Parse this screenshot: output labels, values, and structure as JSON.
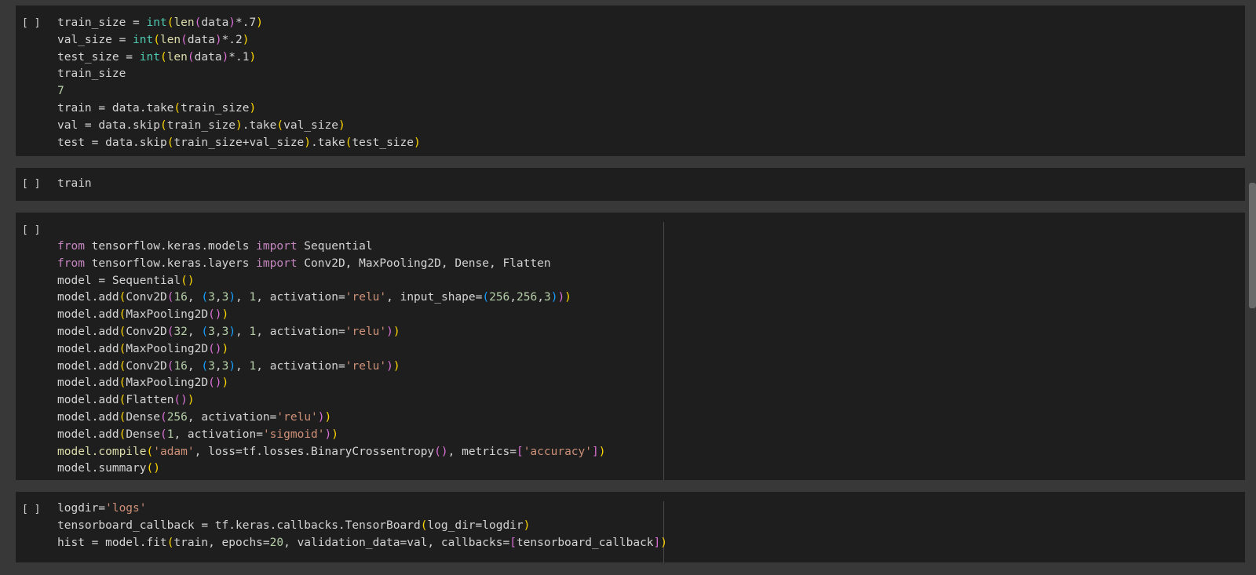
{
  "notebook": {
    "cells": [
      {
        "run_label": "[ ]",
        "lines": [
          [
            [
              "train_size = ",
              "plain"
            ],
            [
              "int",
              "builtin"
            ],
            [
              "(",
              "paren1"
            ],
            [
              "len",
              "func"
            ],
            [
              "(",
              "paren2"
            ],
            [
              "data",
              "plain"
            ],
            [
              ")",
              "paren2"
            ],
            [
              "*.7",
              "plain"
            ],
            [
              ")",
              "paren1"
            ]
          ],
          [
            [
              "val_size = ",
              "plain"
            ],
            [
              "int",
              "builtin"
            ],
            [
              "(",
              "paren1"
            ],
            [
              "len",
              "func"
            ],
            [
              "(",
              "paren2"
            ],
            [
              "data",
              "plain"
            ],
            [
              ")",
              "paren2"
            ],
            [
              "*.2",
              "plain"
            ],
            [
              ")",
              "paren1"
            ]
          ],
          [
            [
              "test_size = ",
              "plain"
            ],
            [
              "int",
              "builtin"
            ],
            [
              "(",
              "paren1"
            ],
            [
              "len",
              "func"
            ],
            [
              "(",
              "paren2"
            ],
            [
              "data",
              "plain"
            ],
            [
              ")",
              "paren2"
            ],
            [
              "*.1",
              "plain"
            ],
            [
              ")",
              "paren1"
            ]
          ],
          [
            [
              "train_size",
              "plain"
            ]
          ],
          [
            [
              "7",
              "number"
            ]
          ],
          [
            [
              "train = data.take",
              "plain"
            ],
            [
              "(",
              "paren1"
            ],
            [
              "train_size",
              "plain"
            ],
            [
              ")",
              "paren1"
            ]
          ],
          [
            [
              "val = data.skip",
              "plain"
            ],
            [
              "(",
              "paren1"
            ],
            [
              "train_size",
              "plain"
            ],
            [
              ")",
              "paren1"
            ],
            [
              ".take",
              "plain"
            ],
            [
              "(",
              "paren1"
            ],
            [
              "val_size",
              "plain"
            ],
            [
              ")",
              "paren1"
            ]
          ],
          [
            [
              "test = data.skip",
              "plain"
            ],
            [
              "(",
              "paren1"
            ],
            [
              "train_size+val_size",
              "plain"
            ],
            [
              ")",
              "paren1"
            ],
            [
              ".take",
              "plain"
            ],
            [
              "(",
              "paren1"
            ],
            [
              "test_size",
              "plain"
            ],
            [
              ")",
              "paren1"
            ]
          ]
        ]
      },
      {
        "run_label": "[ ]",
        "lines": [
          [
            [
              "train",
              "plain"
            ]
          ]
        ]
      },
      {
        "run_label": "[ ]",
        "lines": [
          [
            [
              "from",
              "keyword"
            ],
            [
              " tensorflow.keras.models ",
              "plain"
            ],
            [
              "import",
              "keyword"
            ],
            [
              " Sequential",
              "plain"
            ]
          ],
          [
            [
              "from",
              "keyword"
            ],
            [
              " tensorflow.keras.layers ",
              "plain"
            ],
            [
              "import",
              "keyword"
            ],
            [
              " Conv2D, MaxPooling2D, Dense, Flatten",
              "plain"
            ]
          ],
          [
            [
              "model = Sequential",
              "plain"
            ],
            [
              "()",
              "paren1"
            ]
          ],
          [
            [
              "model.add",
              "plain"
            ],
            [
              "(",
              "paren1"
            ],
            [
              "Conv2D",
              "plain"
            ],
            [
              "(",
              "paren2"
            ],
            [
              "16",
              "number"
            ],
            [
              ", ",
              "plain"
            ],
            [
              "(",
              "paren3"
            ],
            [
              "3",
              "number"
            ],
            [
              ",",
              "plain"
            ],
            [
              "3",
              "number"
            ],
            [
              ")",
              "paren3"
            ],
            [
              ", ",
              "plain"
            ],
            [
              "1",
              "number"
            ],
            [
              ", activation=",
              "plain"
            ],
            [
              "'relu'",
              "string"
            ],
            [
              ", input_shape=",
              "plain"
            ],
            [
              "(",
              "paren3"
            ],
            [
              "256",
              "number"
            ],
            [
              ",",
              "plain"
            ],
            [
              "256",
              "number"
            ],
            [
              ",",
              "plain"
            ],
            [
              "3",
              "number"
            ],
            [
              ")",
              "paren3"
            ],
            [
              ")",
              "paren2"
            ],
            [
              ")",
              "paren1"
            ]
          ],
          [
            [
              "model.add",
              "plain"
            ],
            [
              "(",
              "paren1"
            ],
            [
              "MaxPooling2D",
              "plain"
            ],
            [
              "()",
              "paren2"
            ],
            [
              ")",
              "paren1"
            ]
          ],
          [
            [
              "model.add",
              "plain"
            ],
            [
              "(",
              "paren1"
            ],
            [
              "Conv2D",
              "plain"
            ],
            [
              "(",
              "paren2"
            ],
            [
              "32",
              "number"
            ],
            [
              ", ",
              "plain"
            ],
            [
              "(",
              "paren3"
            ],
            [
              "3",
              "number"
            ],
            [
              ",",
              "plain"
            ],
            [
              "3",
              "number"
            ],
            [
              ")",
              "paren3"
            ],
            [
              ", ",
              "plain"
            ],
            [
              "1",
              "number"
            ],
            [
              ", activation=",
              "plain"
            ],
            [
              "'relu'",
              "string"
            ],
            [
              ")",
              "paren2"
            ],
            [
              ")",
              "paren1"
            ]
          ],
          [
            [
              "model.add",
              "plain"
            ],
            [
              "(",
              "paren1"
            ],
            [
              "MaxPooling2D",
              "plain"
            ],
            [
              "()",
              "paren2"
            ],
            [
              ")",
              "paren1"
            ]
          ],
          [
            [
              "model.add",
              "plain"
            ],
            [
              "(",
              "paren1"
            ],
            [
              "Conv2D",
              "plain"
            ],
            [
              "(",
              "paren2"
            ],
            [
              "16",
              "number"
            ],
            [
              ", ",
              "plain"
            ],
            [
              "(",
              "paren3"
            ],
            [
              "3",
              "number"
            ],
            [
              ",",
              "plain"
            ],
            [
              "3",
              "number"
            ],
            [
              ")",
              "paren3"
            ],
            [
              ", ",
              "plain"
            ],
            [
              "1",
              "number"
            ],
            [
              ", activation=",
              "plain"
            ],
            [
              "'relu'",
              "string"
            ],
            [
              ")",
              "paren2"
            ],
            [
              ")",
              "paren1"
            ]
          ],
          [
            [
              "model.add",
              "plain"
            ],
            [
              "(",
              "paren1"
            ],
            [
              "MaxPooling2D",
              "plain"
            ],
            [
              "()",
              "paren2"
            ],
            [
              ")",
              "paren1"
            ]
          ],
          [
            [
              "model.add",
              "plain"
            ],
            [
              "(",
              "paren1"
            ],
            [
              "Flatten",
              "plain"
            ],
            [
              "()",
              "paren2"
            ],
            [
              ")",
              "paren1"
            ]
          ],
          [
            [
              "model.add",
              "plain"
            ],
            [
              "(",
              "paren1"
            ],
            [
              "Dense",
              "plain"
            ],
            [
              "(",
              "paren2"
            ],
            [
              "256",
              "number"
            ],
            [
              ", activation=",
              "plain"
            ],
            [
              "'relu'",
              "string"
            ],
            [
              ")",
              "paren2"
            ],
            [
              ")",
              "paren1"
            ]
          ],
          [
            [
              "model.add",
              "plain"
            ],
            [
              "(",
              "paren1"
            ],
            [
              "Dense",
              "plain"
            ],
            [
              "(",
              "paren2"
            ],
            [
              "1",
              "number"
            ],
            [
              ", activation=",
              "plain"
            ],
            [
              "'sigmoid'",
              "string"
            ],
            [
              ")",
              "paren2"
            ],
            [
              ")",
              "paren1"
            ]
          ],
          [
            [
              "model.compile",
              "func"
            ],
            [
              "(",
              "paren1"
            ],
            [
              "'adam'",
              "string"
            ],
            [
              ", loss=tf.losses.BinaryCrossentropy",
              "plain"
            ],
            [
              "()",
              "paren2"
            ],
            [
              ", metrics=",
              "plain"
            ],
            [
              "[",
              "paren2"
            ],
            [
              "'accuracy'",
              "string"
            ],
            [
              "]",
              "paren2"
            ],
            [
              ")",
              "paren1"
            ]
          ],
          [
            [
              "model.summary",
              "plain"
            ],
            [
              "()",
              "paren1"
            ]
          ]
        ]
      },
      {
        "run_label": "[ ]",
        "lines": [
          [
            [
              "logdir=",
              "plain"
            ],
            [
              "'logs'",
              "string"
            ]
          ],
          [
            [
              "tensorboard_callback = tf.keras.callbacks.TensorBoard",
              "plain"
            ],
            [
              "(",
              "paren1"
            ],
            [
              "log_dir=logdir",
              "plain"
            ],
            [
              ")",
              "paren1"
            ]
          ],
          [
            [
              "hist = model.fit",
              "plain"
            ],
            [
              "(",
              "paren1"
            ],
            [
              "train, epochs=",
              "plain"
            ],
            [
              "20",
              "number"
            ],
            [
              ", validation_data=val, callbacks=",
              "plain"
            ],
            [
              "[",
              "paren2"
            ],
            [
              "tensorboard_callback",
              "plain"
            ],
            [
              "]",
              "paren2"
            ],
            [
              ")",
              "paren1"
            ]
          ]
        ]
      }
    ]
  }
}
